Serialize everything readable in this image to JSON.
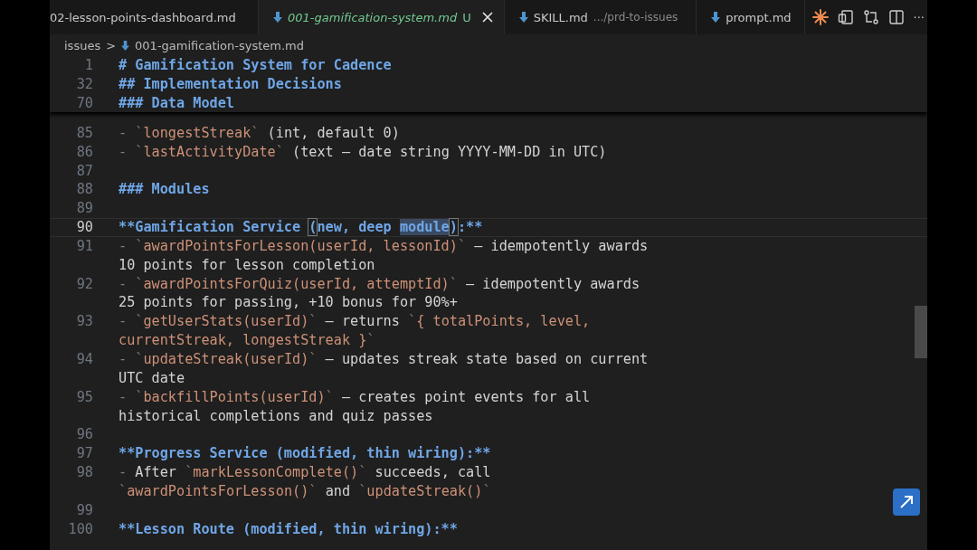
{
  "tabs": [
    {
      "label": "02-lesson-points-dashboard.md",
      "icon": false,
      "selected": false,
      "closable": false
    },
    {
      "label": "001-gamification-system.md",
      "icon": true,
      "selected": true,
      "modified_mark": "U",
      "closable": true
    },
    {
      "label": "SKILL.md",
      "icon": true,
      "selected": false,
      "description": ".../prd-to-issues",
      "closable": false
    },
    {
      "label": "prompt.md",
      "icon": true,
      "selected": false,
      "closable": false
    }
  ],
  "tab_actions": {
    "more": "···"
  },
  "breadcrumb": {
    "folder": "issues",
    "separator": ">",
    "file": "001-gamification-system.md"
  },
  "sticky_lines": [
    {
      "number": "1",
      "text": "# Gamification System for Cadence"
    },
    {
      "number": "32",
      "text": "## Implementation Decisions"
    },
    {
      "number": "70",
      "text": "### Data Model"
    }
  ],
  "lines": [
    {
      "number": "85",
      "current": false,
      "segments": [
        {
          "kind": "mark",
          "text": "- `"
        },
        {
          "kind": "code",
          "text": "longestStreak"
        },
        {
          "kind": "mark",
          "text": "`"
        },
        {
          "kind": "text",
          "text": " (int, default 0)"
        }
      ]
    },
    {
      "number": "86",
      "current": false,
      "segments": [
        {
          "kind": "mark",
          "text": "- `"
        },
        {
          "kind": "code",
          "text": "lastActivityDate"
        },
        {
          "kind": "mark",
          "text": "`"
        },
        {
          "kind": "text",
          "text": " (text — date string YYYY-MM-DD in UTC)"
        }
      ]
    },
    {
      "number": "87",
      "current": false
    },
    {
      "number": "88",
      "current": false,
      "segments": [
        {
          "kind": "heading",
          "text": "### Modules"
        }
      ]
    },
    {
      "number": "89",
      "current": false
    },
    {
      "number": "90",
      "current": true,
      "segments": [
        {
          "kind": "heading",
          "text": "**Gamification Service "
        },
        {
          "kind": "bracket",
          "text": "("
        },
        {
          "kind": "heading",
          "text": "new, deep "
        },
        {
          "kind": "selection",
          "text": "module"
        },
        {
          "kind": "bracket",
          "text": ")"
        },
        {
          "kind": "heading",
          "text": ":**"
        }
      ]
    },
    {
      "number": "91",
      "current": false,
      "segments": [
        {
          "kind": "mark",
          "text": "- `"
        },
        {
          "kind": "code",
          "text": "awardPointsForLesson(userId, lessonId)"
        },
        {
          "kind": "mark",
          "text": "`"
        },
        {
          "kind": "text",
          "text": " — idempotently awards 10 points for lesson completion"
        }
      ]
    },
    {
      "number": "92",
      "current": false,
      "segments": [
        {
          "kind": "mark",
          "text": "- `"
        },
        {
          "kind": "code",
          "text": "awardPointsForQuiz(userId, attemptId)"
        },
        {
          "kind": "mark",
          "text": "`"
        },
        {
          "kind": "text",
          "text": " — idempotently awards 25 points for passing, +10 bonus for 90%+"
        }
      ]
    },
    {
      "number": "93",
      "current": false,
      "segments": [
        {
          "kind": "mark",
          "text": "- `"
        },
        {
          "kind": "code",
          "text": "getUserStats(userId)"
        },
        {
          "kind": "mark",
          "text": "`"
        },
        {
          "kind": "text",
          "text": " — returns "
        },
        {
          "kind": "mark",
          "text": "`"
        },
        {
          "kind": "code",
          "text": "{ totalPoints, level, currentStreak, longestStreak }"
        },
        {
          "kind": "mark",
          "text": "`"
        }
      ]
    },
    {
      "number": "94",
      "current": false,
      "segments": [
        {
          "kind": "mark",
          "text": "- `"
        },
        {
          "kind": "code",
          "text": "updateStreak(userId)"
        },
        {
          "kind": "mark",
          "text": "`"
        },
        {
          "kind": "text",
          "text": " — updates streak state based on current UTC date"
        }
      ]
    },
    {
      "number": "95",
      "current": false,
      "segments": [
        {
          "kind": "mark",
          "text": "- `"
        },
        {
          "kind": "code",
          "text": "backfillPoints(userId)"
        },
        {
          "kind": "mark",
          "text": "`"
        },
        {
          "kind": "text",
          "text": " — creates point events for all historical completions and quiz passes"
        }
      ]
    },
    {
      "number": "96",
      "current": false
    },
    {
      "number": "97",
      "current": false,
      "segments": [
        {
          "kind": "heading",
          "text": "**Progress Service (modified, thin wiring):**"
        }
      ]
    },
    {
      "number": "98",
      "current": false,
      "segments": [
        {
          "kind": "mark",
          "text": "- "
        },
        {
          "kind": "text",
          "text": "After "
        },
        {
          "kind": "mark",
          "text": "`"
        },
        {
          "kind": "code",
          "text": "markLessonComplete()"
        },
        {
          "kind": "mark",
          "text": "`"
        },
        {
          "kind": "text",
          "text": " succeeds, call "
        },
        {
          "kind": "mark",
          "text": "`"
        },
        {
          "kind": "code",
          "text": "awardPointsForLesson()"
        },
        {
          "kind": "mark",
          "text": "`"
        },
        {
          "kind": "text",
          "text": " and "
        },
        {
          "kind": "mark",
          "text": "`"
        },
        {
          "kind": "code",
          "text": "updateStreak()"
        },
        {
          "kind": "mark",
          "text": "`"
        }
      ]
    },
    {
      "number": "99",
      "current": false
    },
    {
      "number": "100",
      "current": false,
      "segments": [
        {
          "kind": "heading",
          "text": "**Lesson Route (modified, thin wiring):**"
        }
      ]
    }
  ]
}
